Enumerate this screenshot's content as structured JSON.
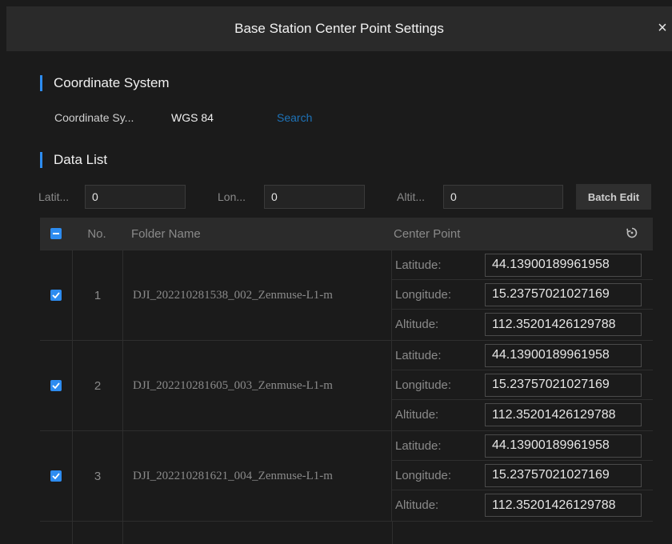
{
  "dialog": {
    "title": "Base Station Center Point Settings",
    "close_glyph": "×"
  },
  "coordinate_section": {
    "title": "Coordinate System",
    "label": "Coordinate Sy...",
    "value": "WGS 84",
    "search_label": "Search"
  },
  "data_section": {
    "title": "Data List"
  },
  "batch": {
    "lat_label": "Latit...",
    "lat_value": "0",
    "lon_label": "Lon...",
    "lon_value": "0",
    "alt_label": "Altit...",
    "alt_value": "0",
    "edit_label": "Batch Edit"
  },
  "table": {
    "headers": {
      "no": "No.",
      "folder": "Folder Name",
      "center": "Center Point"
    },
    "point_labels": {
      "lat": "Latitude:",
      "lon": "Longitude:",
      "alt": "Altitude:"
    },
    "rows": [
      {
        "no": "1",
        "folder": "DJI_202210281538_002_Zenmuse-L1-m",
        "lat": "44.13900189961958",
        "lon": "15.23757021027169",
        "alt": "112.35201426129788"
      },
      {
        "no": "2",
        "folder": "DJI_202210281605_003_Zenmuse-L1-m",
        "lat": "44.13900189961958",
        "lon": "15.23757021027169",
        "alt": "112.35201426129788"
      },
      {
        "no": "3",
        "folder": "DJI_202210281621_004_Zenmuse-L1-m",
        "lat": "44.13900189961958",
        "lon": "15.23757021027169",
        "alt": "112.35201426129788"
      }
    ]
  },
  "icons": {
    "close": "close-icon",
    "select_all": "indeterminate-checkbox-icon",
    "row_check": "checkmark-icon",
    "reset": "refresh-icon"
  },
  "colors": {
    "accent": "#2d8cf0",
    "background": "#1b1b1b",
    "title_bar": "#2a2a2a",
    "link": "#1e73b8"
  }
}
